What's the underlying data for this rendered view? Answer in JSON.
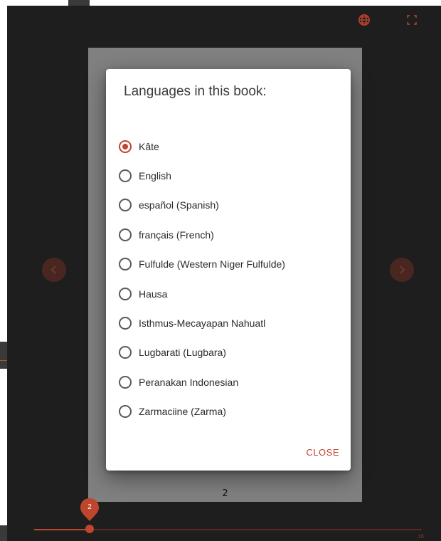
{
  "dialog": {
    "title": "Languages in this book:",
    "selected_index": 0,
    "languages": [
      "Kâte",
      "English",
      "español (Spanish)",
      "français (French)",
      "Fulfulde (Western Niger Fulfulde)",
      "Hausa",
      "Isthmus-Mecayapan Nahuatl",
      "Lugbarati (Lugbara)",
      "Peranakan Indonesian",
      "Zarmaciine (Zarma)"
    ],
    "close_label": "CLOSE"
  },
  "page": {
    "number": "2"
  },
  "scrubber": {
    "current_page": 2,
    "current_label": "2",
    "total_pages": 16,
    "total_label": "16"
  },
  "toolbar": {
    "language_icon": "globe-icon",
    "fullscreen_icon": "fullscreen-icon"
  },
  "colors": {
    "accent": "#c0452e",
    "background": "#1e1e1e",
    "page": "#808080"
  }
}
